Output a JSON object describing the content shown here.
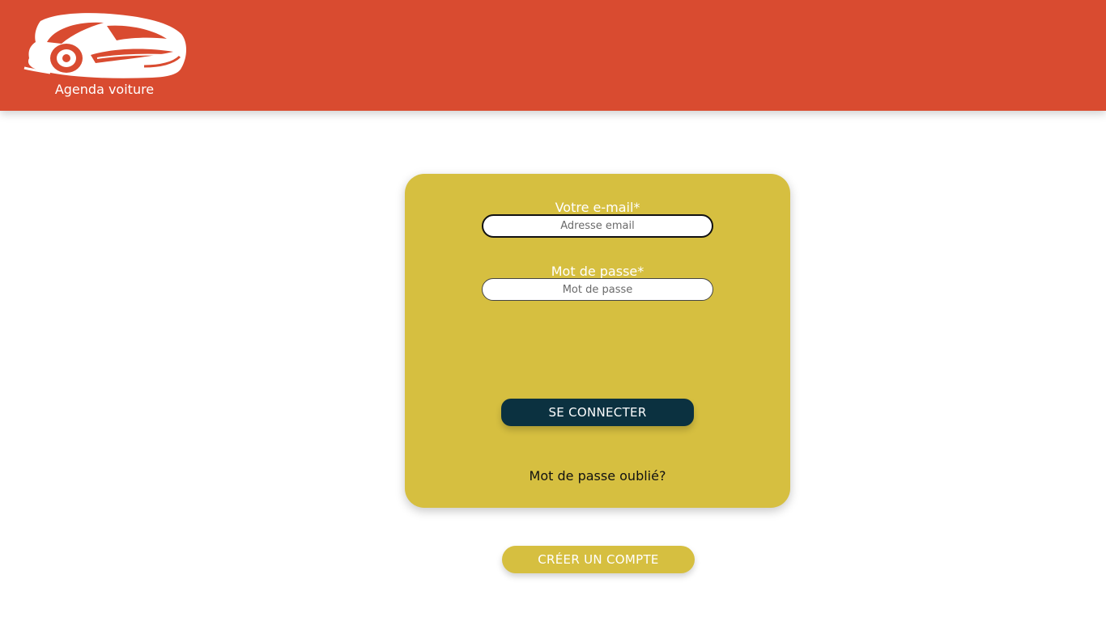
{
  "header": {
    "logo_text": "Agenda voiture",
    "background_color": "#d94b30",
    "logo_icon": "sports-car-icon"
  },
  "login_form": {
    "email_label": "Votre e-mail*",
    "email_placeholder": "Adresse email",
    "email_value": "",
    "password_label": "Mot de passe*",
    "password_placeholder": "Mot de passe",
    "password_value": "",
    "submit_label": "SE CONNECTER",
    "forgot_password_link": "Mot de passe oublié?",
    "card_color": "#d6bf40",
    "submit_color": "#0b3140"
  },
  "create_account": {
    "label": "CRÉER UN COMPTE"
  }
}
